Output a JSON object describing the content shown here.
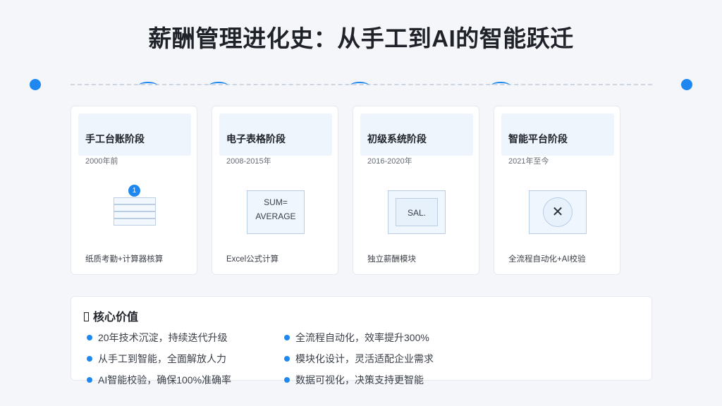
{
  "title": "薪酬管理进化史：从手工到AI的智能跃迁",
  "stages": [
    {
      "title": "手工台账阶段",
      "period": "2000年前",
      "badge": "1",
      "desc": "纸质考勤+计算器核算"
    },
    {
      "title": "电子表格阶段",
      "period": "2008-2015年",
      "formula": [
        "SUM=",
        "AVERAGE"
      ],
      "desc": "Excel公式计算"
    },
    {
      "title": "初级系统阶段",
      "period": "2016-2020年",
      "label": "SAL.",
      "desc": "独立薪酬模块"
    },
    {
      "title": "智能平台阶段",
      "period": "2021年至今",
      "symbol": "✕",
      "desc": "全流程自动化+AI校验"
    }
  ],
  "core_value": {
    "title": "核心价值",
    "items": [
      "20年技术沉淀，持续迭代升级",
      "从手工到智能，全面解放人力",
      "AI智能校验，确保100%准确率",
      "全流程自动化，效率提升300%",
      "模块化设计，灵活适配企业需求",
      "数据可视化，决策支持更智能"
    ]
  },
  "colors": {
    "accent": "#1e88f0",
    "card_head": "#eef5fd",
    "background": "#f4f6fa"
  }
}
